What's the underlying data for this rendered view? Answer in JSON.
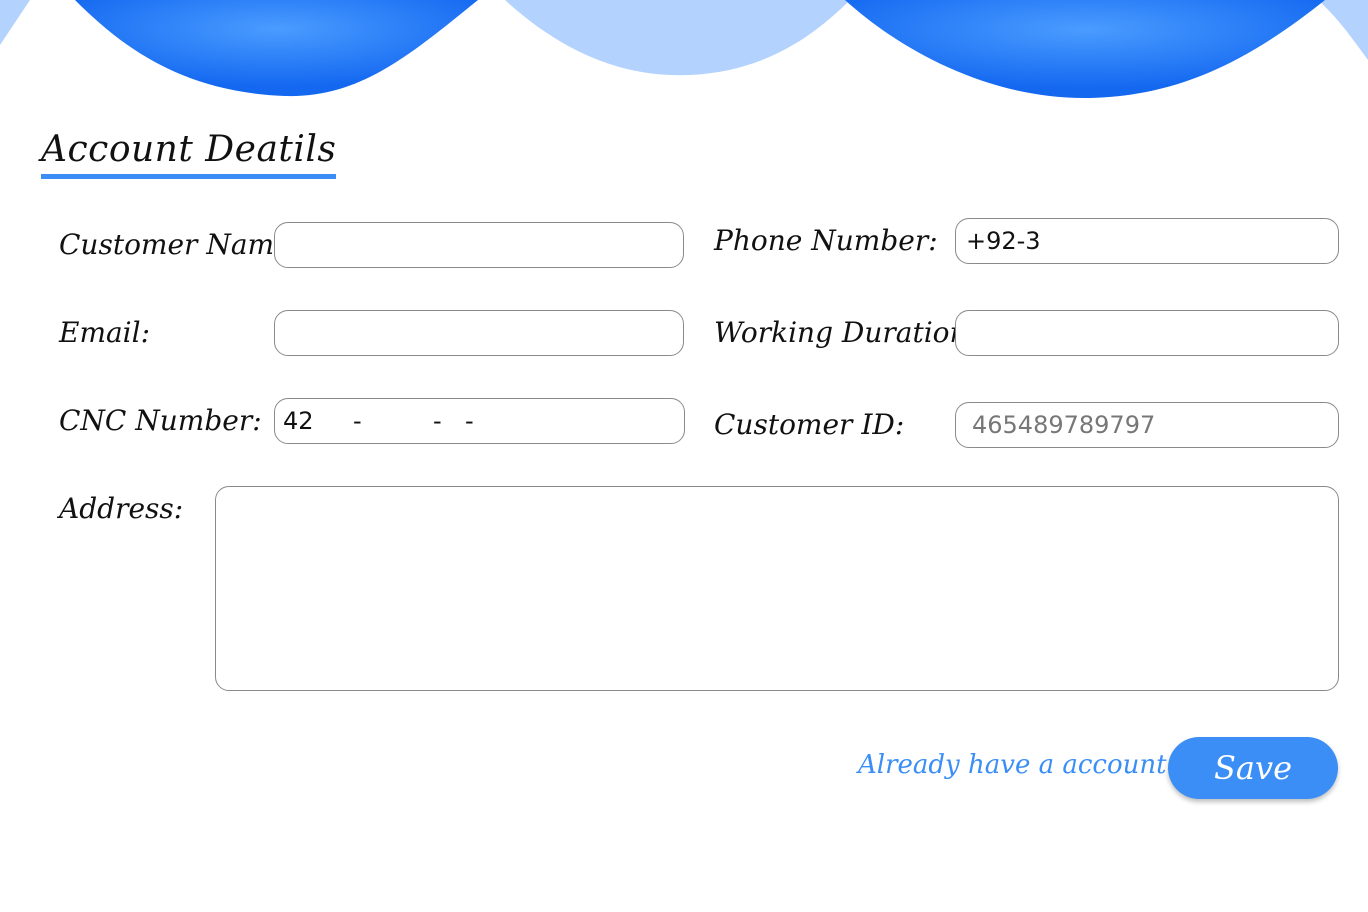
{
  "form": {
    "title": "Account Deatils",
    "labels": {
      "customer_name": "Customer Name:",
      "email": "Email:",
      "cnc_number": "CNC Number:",
      "address": "Address:",
      "phone_number": "Phone Number:",
      "working_duration": "Working Duration:",
      "customer_id": "Customer ID:"
    },
    "values": {
      "customer_name": "",
      "email": "",
      "cnc_part1": "42",
      "cnc_sep1": "-",
      "cnc_sep2": "-",
      "cnc_sep3": "-",
      "phone_number": "+92-3",
      "working_duration": "",
      "address": ""
    },
    "placeholders": {
      "customer_id": "465489789797"
    }
  },
  "actions": {
    "login_link": "Already have a account !",
    "save_label": "Save"
  },
  "colors": {
    "accent": "#3a8ef6",
    "wave_dark": "#1a6ef5",
    "wave_light": "#b3d2fd"
  }
}
